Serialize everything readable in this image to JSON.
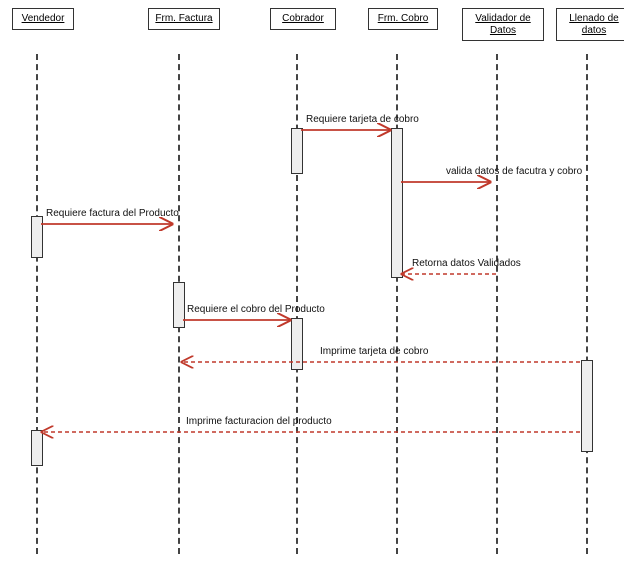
{
  "participants": {
    "vendedor": "Vendedor",
    "frm_factura": "Frm. Factura",
    "cobrador": "Cobrador",
    "frm_cobro": "Frm. Cobro",
    "validador": "Validador de\nDatos",
    "llenado": "Llenado de\ndatos"
  },
  "messages": {
    "m1": "Requiere tarjeta de cobro",
    "m2": "valida datos de facutra y cobro",
    "m3": "Requiere factura del Producto",
    "m4": "Retorna datos Validados",
    "m5": "Requiere el cobro del Producto",
    "m6": "Imprime tarjeta de cobro",
    "m7": "Imprime facturacion del producto"
  }
}
